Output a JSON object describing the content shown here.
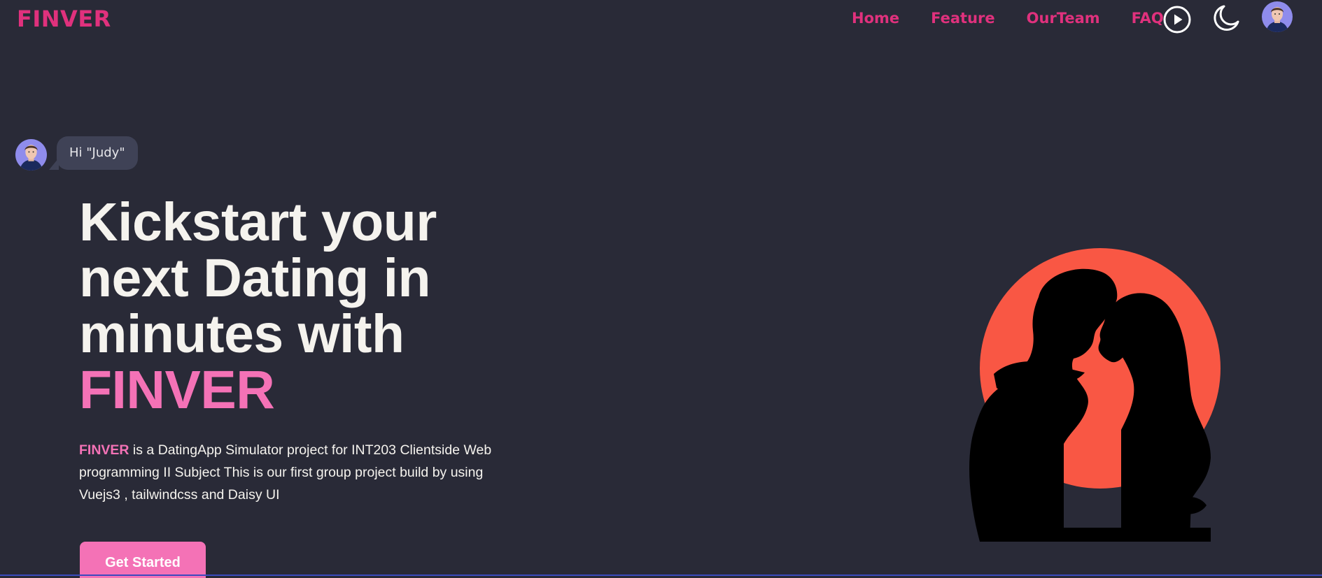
{
  "navbar": {
    "brand": "FINVER",
    "links": [
      "Home",
      "Feature",
      "OurTeam",
      "FAQ"
    ],
    "play_icon": "play-circle-icon",
    "theme_icon": "moon-icon",
    "avatar_icon": "user-avatar"
  },
  "chat": {
    "message": "Hi \"Judy\""
  },
  "hero": {
    "title_line1": "Kickstart your",
    "title_line2": "next Dating in",
    "title_line3": "minutes with",
    "title_accent": "FINVER",
    "desc_accent": "FINVER",
    "description": " is a DatingApp Simulator project for INT203 Clientside Web programming II Subject This is our first group project build by using Vuejs3 , tailwindcss and Daisy UI",
    "cta_label": "Get Started"
  },
  "colors": {
    "background": "#292a37",
    "brand_pink": "#e0317d",
    "accent_pink": "#f472b6",
    "sun_red": "#f95744",
    "bubble": "#3f4256"
  }
}
